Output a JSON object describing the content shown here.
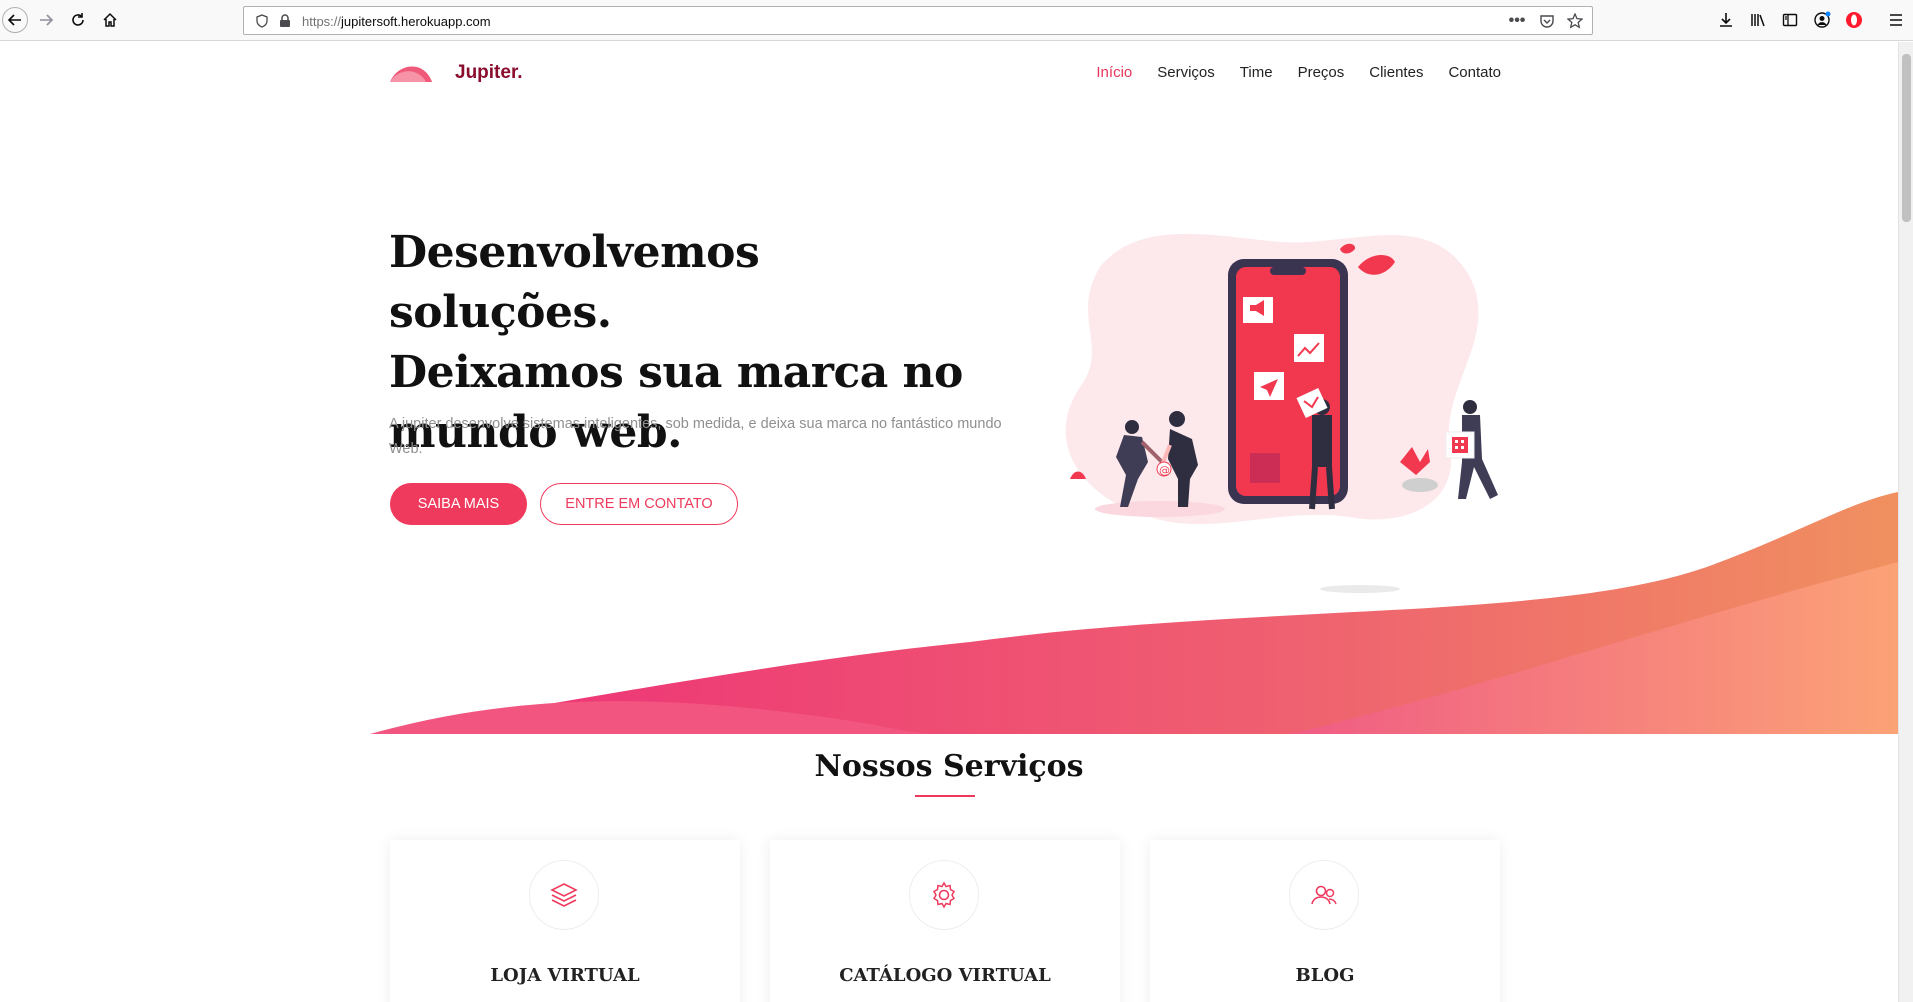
{
  "browser": {
    "url_scheme": "https://",
    "url_host": "jupitersoft.herokuapp.com"
  },
  "site": {
    "brand": "Jupiter.",
    "nav": [
      {
        "label": "Início",
        "active": true
      },
      {
        "label": "Serviços",
        "active": false
      },
      {
        "label": "Time",
        "active": false
      },
      {
        "label": "Preços",
        "active": false
      },
      {
        "label": "Clientes",
        "active": false
      },
      {
        "label": "Contato",
        "active": false
      }
    ]
  },
  "hero": {
    "title_line1": "Desenvolvemos soluções.",
    "title_line2": "Deixamos sua marca no",
    "title_line3": "mundo web.",
    "subtitle": "A jupiter desenvolve sistemas inteligentes, sob medida, e deixa sua marca no fantástico mundo Web.",
    "primary_button": "SAIBA MAIS",
    "secondary_button": "ENTRE EM CONTATO"
  },
  "services": {
    "title": "Nossos Serviços",
    "cards": [
      {
        "title": "LOJA VIRTUAL",
        "icon": "layers-icon"
      },
      {
        "title": "CATÁLOGO VIRTUAL",
        "icon": "gear-icon"
      },
      {
        "title": "BLOG",
        "icon": "users-icon"
      }
    ]
  },
  "colors": {
    "accent": "#ef3a5d",
    "brand_dark": "#8a0d2e"
  }
}
